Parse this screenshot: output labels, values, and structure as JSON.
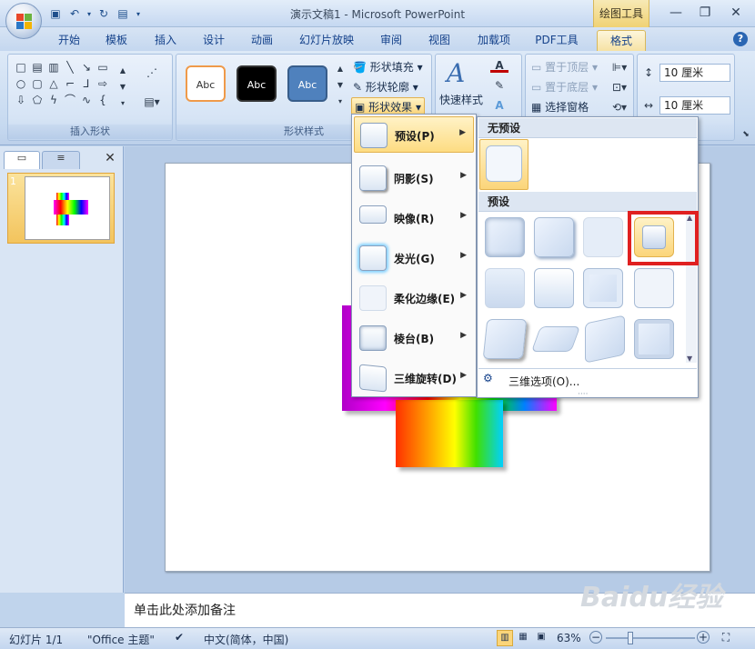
{
  "window": {
    "title": "演示文稿1 - Microsoft PowerPoint",
    "context_tab": "绘图工具"
  },
  "tabs": [
    "开始",
    "模板",
    "插入",
    "设计",
    "动画",
    "幻灯片放映",
    "审阅",
    "视图",
    "加载项",
    "PDF工具",
    "格式"
  ],
  "active_tab": "格式",
  "ribbon": {
    "group_insert_shapes": "插入形状",
    "group_shape_styles": "形状样式",
    "style_swatches": [
      "Abc",
      "Abc",
      "Abc"
    ],
    "shape_fill": "形状填充",
    "shape_outline": "形状轮廓",
    "shape_effects": "形状效果",
    "quick_styles": "快速样式",
    "bring_front": "置于顶层",
    "send_back": "置于底层",
    "selection_pane": "选择窗格",
    "height": "10 厘米",
    "width": "10 厘米"
  },
  "effects_menu": {
    "items": [
      {
        "label": "预设(P)"
      },
      {
        "label": "阴影(S)"
      },
      {
        "label": "映像(R)"
      },
      {
        "label": "发光(G)"
      },
      {
        "label": "柔化边缘(E)"
      },
      {
        "label": "棱台(B)"
      },
      {
        "label": "三维旋转(D)"
      }
    ],
    "highlighted": "预设(P)"
  },
  "preset_gallery": {
    "no_preset_header": "无预设",
    "preset_header": "预设",
    "footer": "三维选项(O)..."
  },
  "slide_panel": {
    "slide_number": "1"
  },
  "notes": {
    "placeholder": "单击此处添加备注"
  },
  "status": {
    "slide": "幻灯片 1/1",
    "theme": "\"Office 主题\"",
    "language": "中文(简体，中国)",
    "zoom": "63%"
  },
  "watermark": "Baidu经验",
  "colors": {
    "accent_highlight": "#fddc82",
    "annotation": "#e02020"
  }
}
